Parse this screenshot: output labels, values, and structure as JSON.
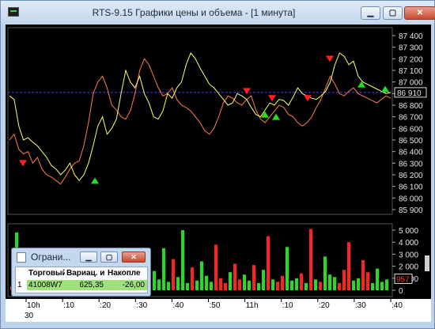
{
  "window": {
    "title": "RTS-9.15 Графики цены и объема - [1 минута]",
    "minimize_glyph": "▁",
    "maximize_glyph": "▢",
    "close_glyph": "✕"
  },
  "price_axis": {
    "ticks": [
      "87 400",
      "87 300",
      "87 200",
      "87 100",
      "87 000",
      "86 900",
      "86 800",
      "86 700",
      "86 600",
      "86 500",
      "86 400",
      "86 300",
      "86 200",
      "86 100",
      "86 000",
      "85 900"
    ],
    "current_price": "86 910",
    "current_price_color": "#ffffff"
  },
  "volume_axis": {
    "ticks": [
      "5 000",
      "4 000",
      "3 000",
      "2 000",
      "1 000",
      "0"
    ],
    "current_volume": "957",
    "current_volume_color": "#ff3030"
  },
  "time_axis": {
    "labels": [
      "10h",
      ":10",
      ":20",
      ":30",
      ":40",
      ":50",
      "11h",
      ":10",
      ":20",
      ":30",
      ":40"
    ],
    "extra": "30"
  },
  "colors": {
    "price_line": "#ffff66",
    "secondary_line": "#ff7b4a",
    "current_line": "#4040ff",
    "up_marker": "#22dd22",
    "down_marker": "#ff2020",
    "volume_green": "#22dd22",
    "volume_red": "#ff2020"
  },
  "mini_window": {
    "title": "Ограни...",
    "headers": [
      "Торговый",
      "Вариац. и",
      "Накопле"
    ],
    "row_index": "1",
    "row": [
      "41008W7",
      "625,35",
      "-26,00"
    ]
  }
}
